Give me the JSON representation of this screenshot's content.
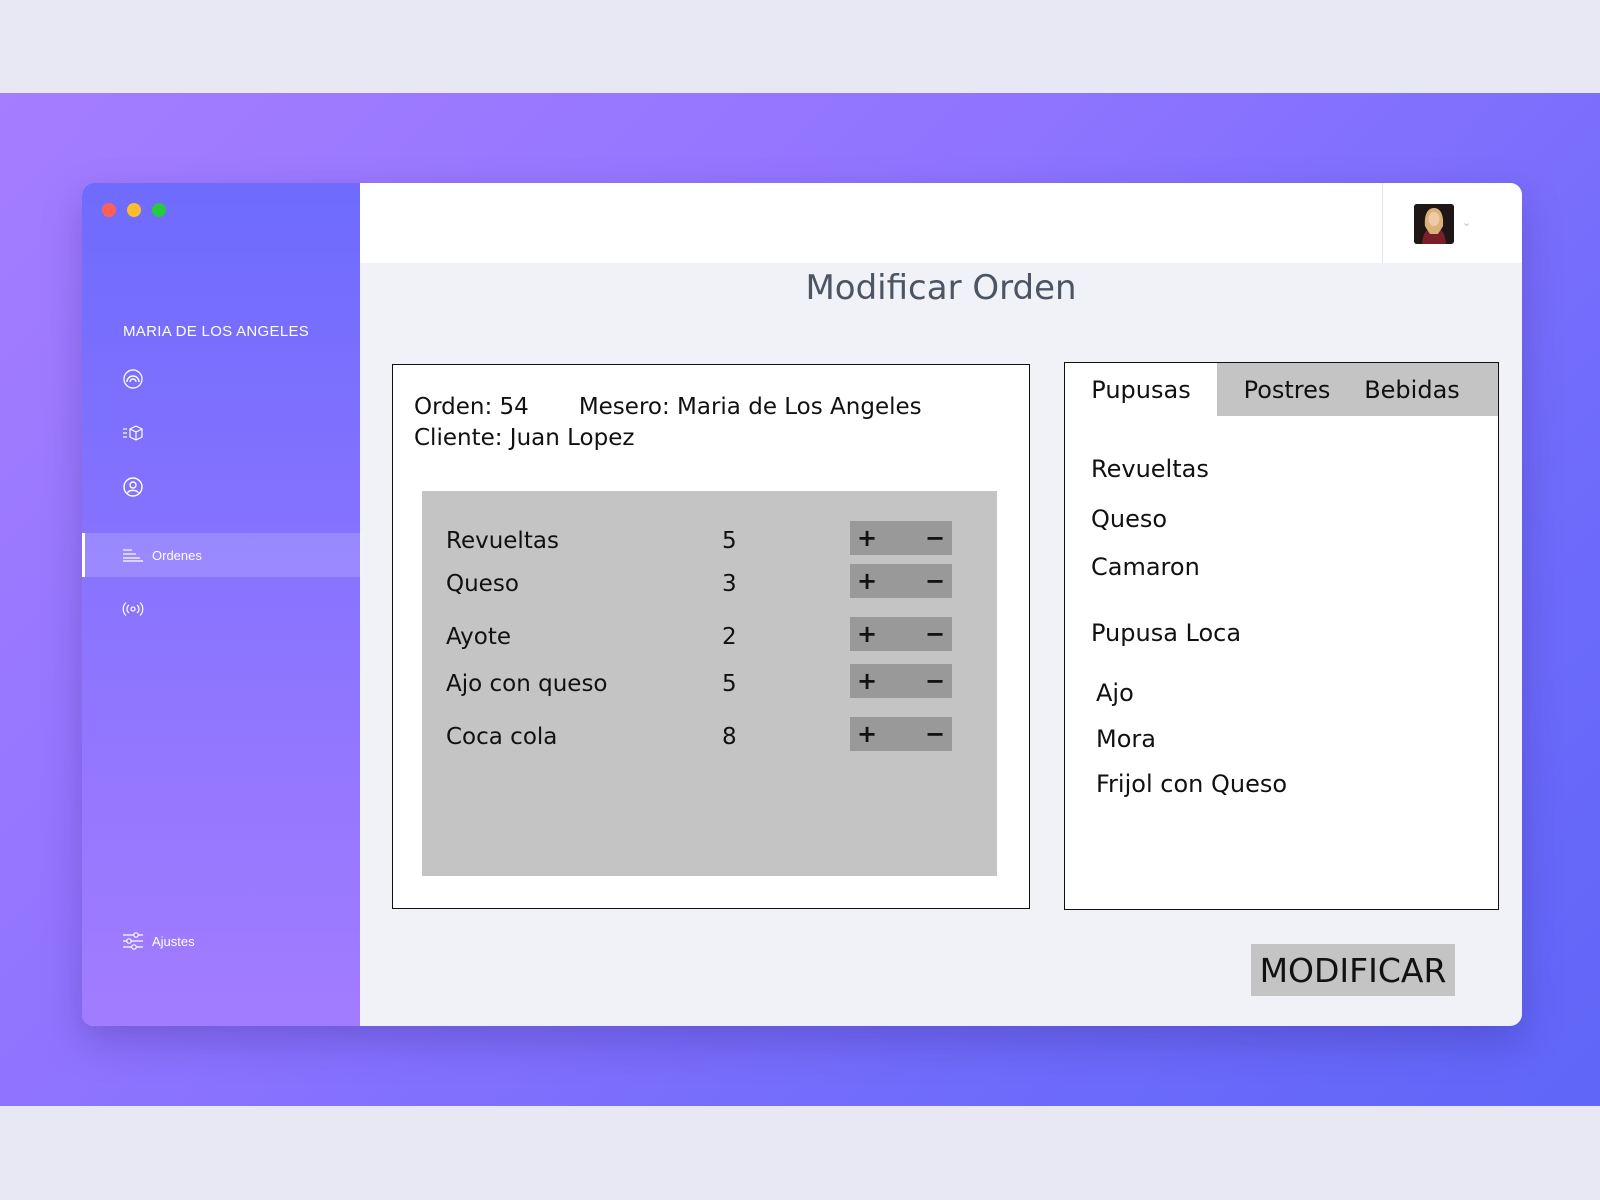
{
  "window": {
    "traffic_lights": [
      "#ff5f56",
      "#ffbd2e",
      "#27c93f"
    ]
  },
  "sidebar": {
    "user_name": "MARIA DE LOS ANGELES",
    "items": [
      {
        "icon": "dashboard-icon",
        "label": ""
      },
      {
        "icon": "inventory-icon",
        "label": ""
      },
      {
        "icon": "user-icon",
        "label": ""
      },
      {
        "icon": "orders-list-icon",
        "label": "Ordenes",
        "active": true
      },
      {
        "icon": "broadcast-icon",
        "label": ""
      }
    ],
    "settings_label": "Ajustes"
  },
  "header": {
    "avatar": "user-avatar",
    "menu_icon": "chevron-down-icon"
  },
  "page": {
    "title": "Modificar Orden"
  },
  "order": {
    "number_text": "Orden: 54",
    "waiter_text": "Mesero: Maria de Los Angeles",
    "client_text": "Cliente: Juan Lopez",
    "items": [
      {
        "name": "Revueltas",
        "qty": "5"
      },
      {
        "name": "Queso",
        "qty": "3"
      },
      {
        "name": "Ayote",
        "qty": "2"
      },
      {
        "name": "Ajo con queso",
        "qty": "5"
      },
      {
        "name": "Coca cola",
        "qty": "8"
      }
    ],
    "plus_label": "+",
    "minus_label": "−"
  },
  "menu": {
    "tabs": [
      {
        "label": "Pupusas",
        "active": true
      },
      {
        "label": "Postres"
      },
      {
        "label": "Bebidas"
      }
    ],
    "items": [
      "Revueltas",
      "Queso",
      "Camaron",
      "Pupusa Loca",
      "Ajo",
      "Mora",
      "Frijol con Queso"
    ]
  },
  "actions": {
    "modify_label": "MODIFICAR"
  }
}
